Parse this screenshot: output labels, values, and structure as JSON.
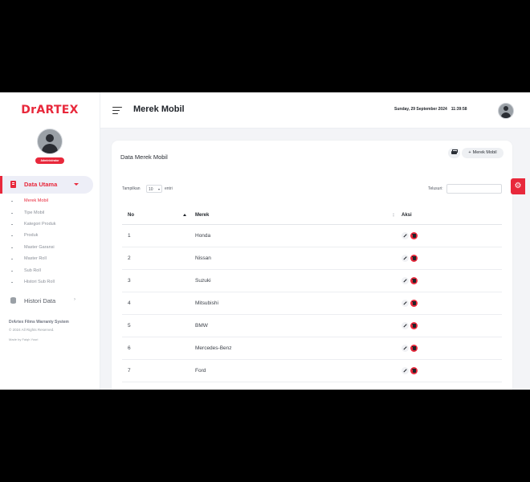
{
  "sidebar": {
    "logo": "DrARTEX",
    "role": "Administrator",
    "group_label": "Data Utama",
    "items": [
      {
        "label": "Merek Mobil",
        "active": true
      },
      {
        "label": "Tipe Mobil"
      },
      {
        "label": "Kategori Produk"
      },
      {
        "label": "Produk"
      },
      {
        "label": "Master Garansi"
      },
      {
        "label": "Master Roll"
      },
      {
        "label": "Sub Roll"
      },
      {
        "label": "Histori Sub Roll"
      }
    ],
    "history_label": "Histori Data",
    "footer_title": "DrArtex Films Warranty System",
    "footer_copy": "© 2024 All Rights Reserved.",
    "footer_made": "Made by Faiqh Yusri"
  },
  "header": {
    "title": "Merek Mobil",
    "date": "Sunday, 29 September 2024",
    "time": "11:39:58"
  },
  "card": {
    "title": "Data Merek Mobil",
    "add_label": "Merek Mobil",
    "show_label": "Tampilkan",
    "show_value": "10",
    "entries_label": "entri",
    "search_label": "Telusuri:"
  },
  "table": {
    "headers": [
      "No",
      "Merek",
      "Aksi"
    ],
    "rows": [
      {
        "no": "1",
        "merek": "Honda"
      },
      {
        "no": "2",
        "merek": "Nissan"
      },
      {
        "no": "3",
        "merek": "Suzuki"
      },
      {
        "no": "4",
        "merek": "Mitsubishi"
      },
      {
        "no": "5",
        "merek": "BMW"
      },
      {
        "no": "6",
        "merek": "Mercedes-Benz"
      },
      {
        "no": "7",
        "merek": "Ford"
      }
    ]
  },
  "colors": {
    "accent": "#e8283b",
    "background": "#f3f4f7"
  }
}
